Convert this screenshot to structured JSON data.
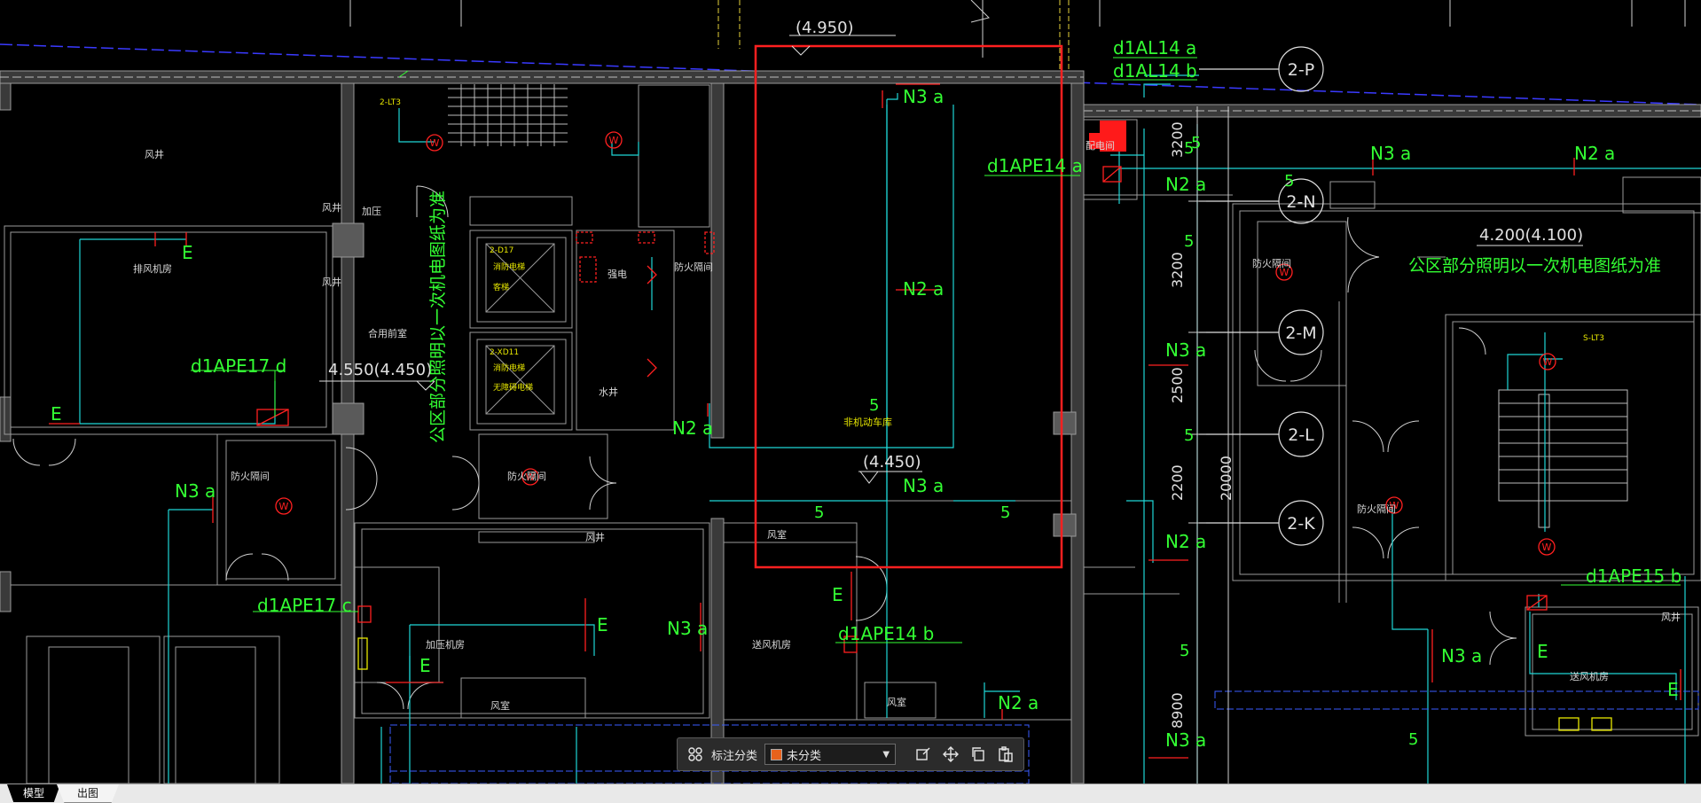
{
  "viewport": {
    "accent_red": "#ff2020",
    "green_text": "#33ff33",
    "cyan_line": "#1fd6d6",
    "wall_color": "#8a8a8a",
    "elevations": [
      "(4.950)",
      "4.550(4.450)",
      "(4.450)",
      "4.200(4.100)"
    ],
    "axis_labels": [
      "2-P",
      "2-N",
      "2-M",
      "2-L",
      "2-K"
    ],
    "dimensions": [
      "3200",
      "3200",
      "2500",
      "2200",
      "20000",
      "8900"
    ],
    "circuit_labels": {
      "d1AL14a": "d1AL14 a",
      "d1AL14b": "d1AL14 b",
      "d1APE14a": "d1APE14 a",
      "d1APE14b": "d1APE14 b",
      "d1APE17d": "d1APE17 d",
      "d1APE17c": "d1APE17 c",
      "d1APE15b": "d1APE15 b",
      "N3a": "N3 a",
      "N2a": "N2 a",
      "E": "E",
      "five": "5"
    },
    "note_vertical": "公区部分照明以一次机电图纸为准",
    "note_horizontal": "公区部分照明以一次机电图纸为准",
    "rooms": {
      "fengjing": "风井",
      "paifeng": "排风机房",
      "jiaya": "加压",
      "fenghu": "风井",
      "heyong": "合用前室",
      "fanghuo": "防火隔间",
      "jiaya_jifang": "加压机房",
      "fengshi": "风室",
      "songfeng": "送风机房",
      "feijidong": "非机动车库",
      "peidianjian": "配电间",
      "shuijing": "水井",
      "dianjing": "强电",
      "fanghuo2": "防火隔间"
    },
    "elevators": {
      "d17_code": "2-D17",
      "d17_a": "消防电梯",
      "d17_b": "客梯",
      "xd11_code": "2-XD11",
      "xd11_a": "消防电梯",
      "xd11_b": "无障碍电梯"
    },
    "stair_labels": {
      "left": "2-LT3",
      "right": "S-LT3"
    }
  },
  "toolbar": {
    "grid_icon": "grid-icon",
    "label": "标注分类",
    "selected_category": "未分类",
    "swatch_color": "#e8621c",
    "tools": [
      "edit-icon",
      "move-icon",
      "copy-icon",
      "paste-icon"
    ]
  },
  "tabs": {
    "model": "模型",
    "layout": "出图"
  }
}
